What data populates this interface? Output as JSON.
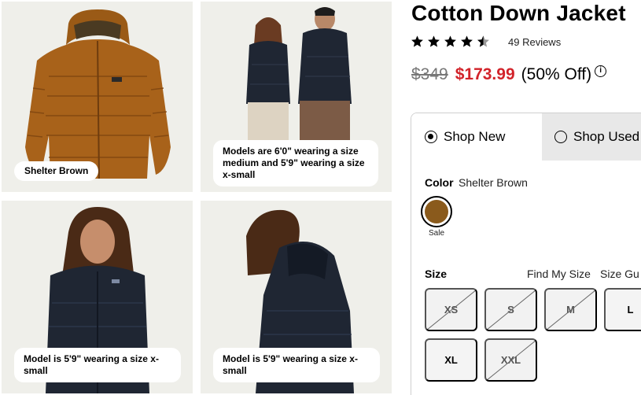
{
  "product": {
    "title": "Cotton Down Jacket",
    "rating": 4.5,
    "reviews": "49 Reviews",
    "original_price": "$349",
    "sale_price": "$173.99",
    "discount": "(50% Off)",
    "info_icon": "info-icon"
  },
  "gallery": [
    {
      "caption": "Shelter Brown"
    },
    {
      "caption": "Models are 6'0\" wearing a size medium and 5'9\" wearing a size x-small"
    },
    {
      "caption": "Model is 5'9\" wearing a size x-small"
    },
    {
      "caption": "Model is 5'9\" wearing a size x-small"
    }
  ],
  "shop_tabs": [
    {
      "label": "Shop New",
      "selected": true
    },
    {
      "label": "Shop Used",
      "selected": false
    }
  ],
  "color": {
    "label": "Color",
    "value": "Shelter Brown",
    "swatch_hex": "#8a5a1c",
    "tag": "Sale"
  },
  "size": {
    "label": "Size",
    "find_my_size": "Find My Size",
    "size_guide": "Size Gu",
    "options": [
      {
        "label": "XS",
        "available": false
      },
      {
        "label": "S",
        "available": false
      },
      {
        "label": "M",
        "available": false
      },
      {
        "label": "L",
        "available": true
      },
      {
        "label": "XL",
        "available": true
      },
      {
        "label": "XXL",
        "available": false
      }
    ]
  },
  "colors": {
    "sale_red": "#d2232a",
    "jacket_brown": "#a8621a",
    "jacket_navy": "#1f2633",
    "tile_bg": "#efefea"
  }
}
